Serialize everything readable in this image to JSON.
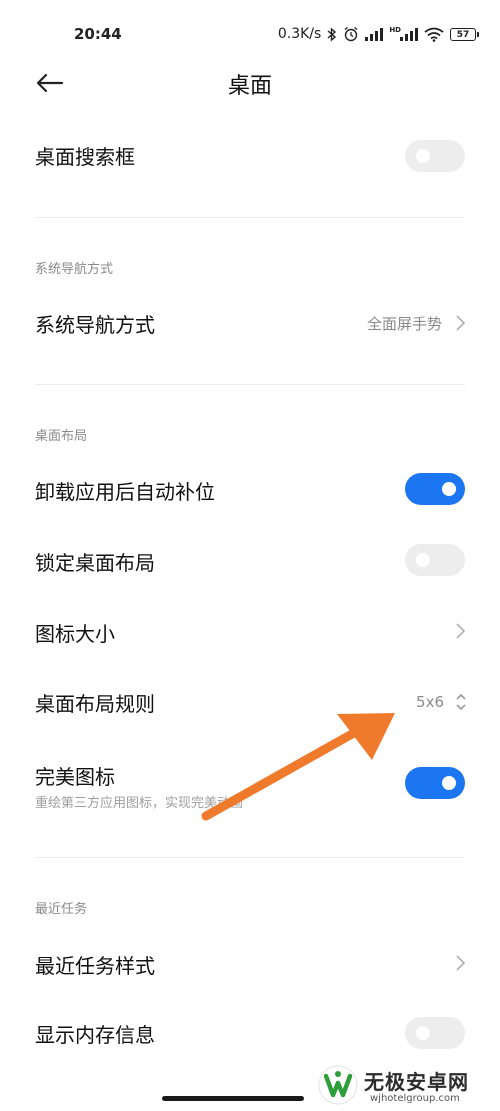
{
  "status_bar": {
    "time": "20:44",
    "speed": "0.3K/s",
    "battery": "57"
  },
  "header": {
    "title": "桌面"
  },
  "rows": {
    "search_box": {
      "label": "桌面搜索框",
      "enabled": false
    },
    "nav_section_title": "系统导航方式",
    "nav": {
      "label": "系统导航方式",
      "value": "全面屏手势"
    },
    "layout_section_title": "桌面布局",
    "auto_fill": {
      "label": "卸载应用后自动补位",
      "enabled": true
    },
    "lock_layout": {
      "label": "锁定桌面布局",
      "enabled": false
    },
    "icon_size": {
      "label": "图标大小"
    },
    "layout_rule": {
      "label": "桌面布局规则",
      "value": "5x6"
    },
    "perfect_icons": {
      "label": "完美图标",
      "subtitle": "重绘第三方应用图标，实现完美动画",
      "enabled": true
    },
    "recent_section_title": "最近任务",
    "recent_style": {
      "label": "最近任务样式"
    },
    "memory_info": {
      "label": "显示内存信息",
      "enabled": false
    }
  },
  "watermark": {
    "name": "无极安卓网",
    "url": "wjhotelgroup.com"
  },
  "colors": {
    "accent": "#1c76f2",
    "toggle_off": "#ededed",
    "annotation_arrow": "#f07a2c"
  }
}
